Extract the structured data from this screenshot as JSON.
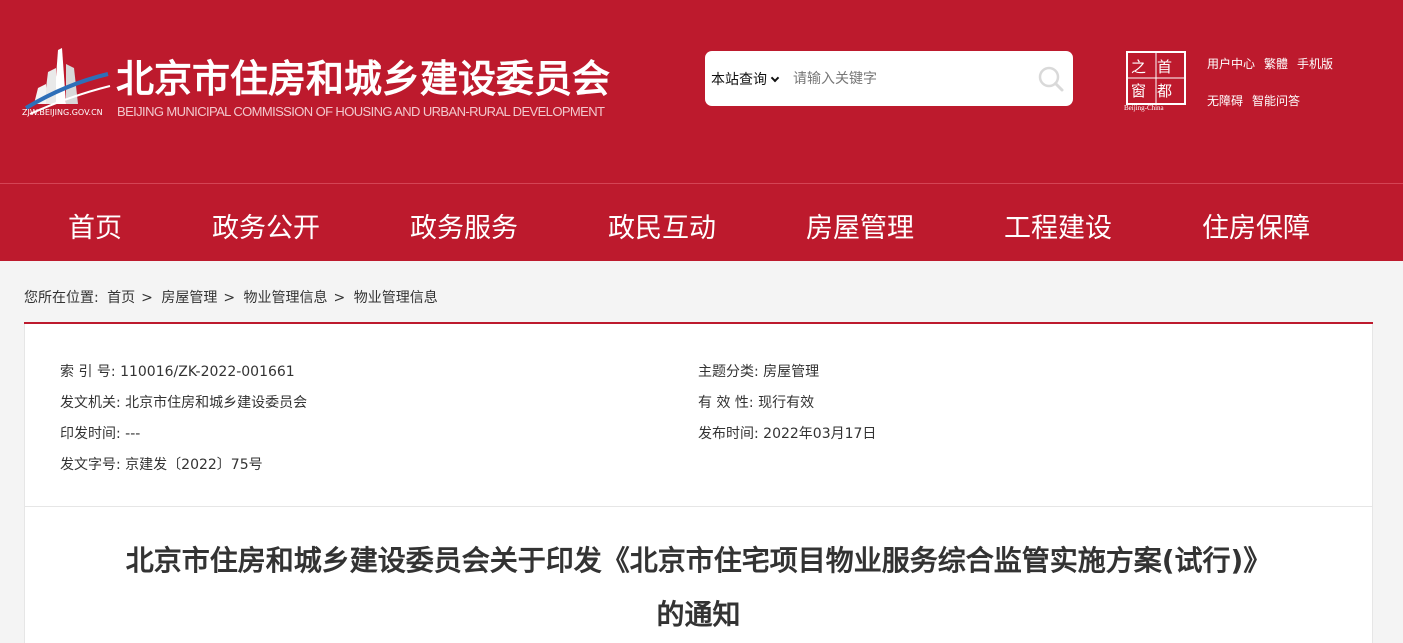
{
  "site": {
    "domain_text": "ZJW.BEIJING.GOV.CN",
    "title_cn": "北京市住房和城乡建设委员会",
    "title_en": "BEIJING MUNICIPAL COMMISSION OF HOUSING AND URBAN-RURAL DEVELOPMENT",
    "badge_chars": [
      "首",
      "都",
      "之",
      "窗"
    ],
    "badge_sub": "Beijing-China",
    "brand_color": "#bd1a2d"
  },
  "search": {
    "scope": "本站查询",
    "placeholder": "请输入关键字"
  },
  "toplinks": {
    "row1": [
      "用户中心",
      "繁體",
      "手机版"
    ],
    "row2": [
      "无障碍",
      "智能问答"
    ]
  },
  "nav": [
    "首页",
    "政务公开",
    "政务服务",
    "政民互动",
    "房屋管理",
    "工程建设",
    "住房保障"
  ],
  "breadcrumb": {
    "prefix": "您所在位置:",
    "items": [
      "首页",
      "房屋管理",
      "物业管理信息",
      "物业管理信息"
    ],
    "separator": ">"
  },
  "meta": {
    "index_label": "索 引 号:",
    "index_value": "110016/ZK-2022-001661",
    "topic_label": "主题分类:",
    "topic_value": "房屋管理",
    "issuer_label": "发文机关:",
    "issuer_value": "北京市住房和城乡建设委员会",
    "validity_label": "有 效 性:",
    "validity_value": "现行有效",
    "print_label": "印发时间:",
    "print_value": "---",
    "publish_label": "发布时间:",
    "publish_value": "2022年03月17日",
    "docno_label": "发文字号:",
    "docno_value": "京建发〔2022〕75号"
  },
  "document": {
    "title_line1": "北京市住房和城乡建设委员会关于印发《北京市住宅项目物业服务综合监管实施方案(试行)》",
    "title_line2": "的通知"
  }
}
